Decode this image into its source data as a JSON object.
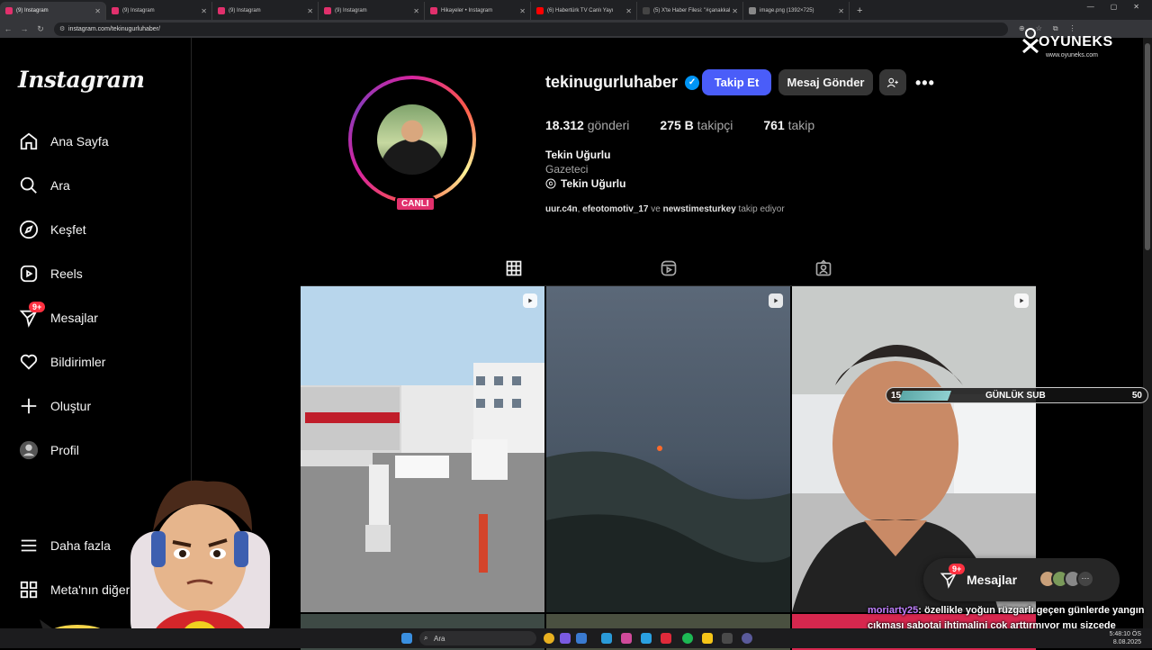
{
  "browser": {
    "tabs": [
      {
        "title": "(9) Instagram",
        "active": true,
        "color": "#e1306c"
      },
      {
        "title": "(9) Instagram",
        "active": false,
        "color": "#e1306c"
      },
      {
        "title": "(9) Instagram",
        "active": false,
        "color": "#e1306c"
      },
      {
        "title": "(9) Instagram",
        "active": false,
        "color": "#e1306c"
      },
      {
        "title": "Hikayeler • Instagram",
        "active": false,
        "color": "#e1306c"
      },
      {
        "title": "(6) Habertürk TV Canlı Yayı",
        "active": false,
        "color": "#ff0000"
      },
      {
        "title": "(5) X'te Haber Filesi: \"#çanakkal",
        "active": false,
        "color": "#444444"
      },
      {
        "title": "image.png (1392×725)",
        "active": false,
        "color": "#888888"
      }
    ],
    "url": "instagram.com/tekinugurluhaber/"
  },
  "sidebar": {
    "logo": "Instagram",
    "items": [
      {
        "label": "Ana Sayfa",
        "icon": "home-icon"
      },
      {
        "label": "Ara",
        "icon": "search-icon"
      },
      {
        "label": "Keşfet",
        "icon": "compass-icon"
      },
      {
        "label": "Reels",
        "icon": "reels-icon"
      },
      {
        "label": "Mesajlar",
        "icon": "messenger-icon",
        "badge": "9+"
      },
      {
        "label": "Bildirimler",
        "icon": "heart-icon"
      },
      {
        "label": "Oluştur",
        "icon": "plus-icon"
      },
      {
        "label": "Profil",
        "icon": "profile-icon"
      }
    ],
    "more": "Daha fazla",
    "meta": "Meta'nın diğer ür"
  },
  "profile": {
    "username": "tekinugurluhaber",
    "live_badge": "CANLI",
    "follow_label": "Takip Et",
    "message_label": "Mesaj Gönder",
    "more_glyph": "•••",
    "posts_count": "18.312",
    "posts_label": "gönderi",
    "followers_count": "275 B",
    "followers_label": "takipçi",
    "following_count": "761",
    "following_label": "takip",
    "full_name": "Tekin Uğurlu",
    "category": "Gazeteci",
    "threads_name": "Tekin Uğurlu",
    "followed_by_1": "uur.c4n",
    "followed_by_sep1": ", ",
    "followed_by_2": "efeotomotiv_17",
    "followed_by_ve": " ve ",
    "followed_by_3": "newstimesturkey",
    "followed_by_tail": " takip ediyor"
  },
  "overlay": {
    "sub_current": "15",
    "sub_label": "GÜNLÜK SUB",
    "sub_goal": "50",
    "sub_progress": 0.3,
    "messages_label": "Mesajlar",
    "messages_badge": "9+",
    "brand": "OYUNEKS",
    "brand_site": "www.oyuneks.com",
    "chat_user": "moriarty25",
    "chat_sep": ": ",
    "chat_text": "özellikle yoğun rüzgarlı geçen günlerde yangın çıkması sabotaj ihtimalini çok arttırmıyor mu sizcede"
  },
  "taskbar": {
    "search_placeholder": "Ara",
    "time": "5:48:10 ÖS",
    "date": "8.08.2025"
  },
  "colors": {
    "follow_button": "#4a5df9",
    "secondary_button": "#363636",
    "badge": "#ff3040",
    "live": "#e1306c"
  }
}
